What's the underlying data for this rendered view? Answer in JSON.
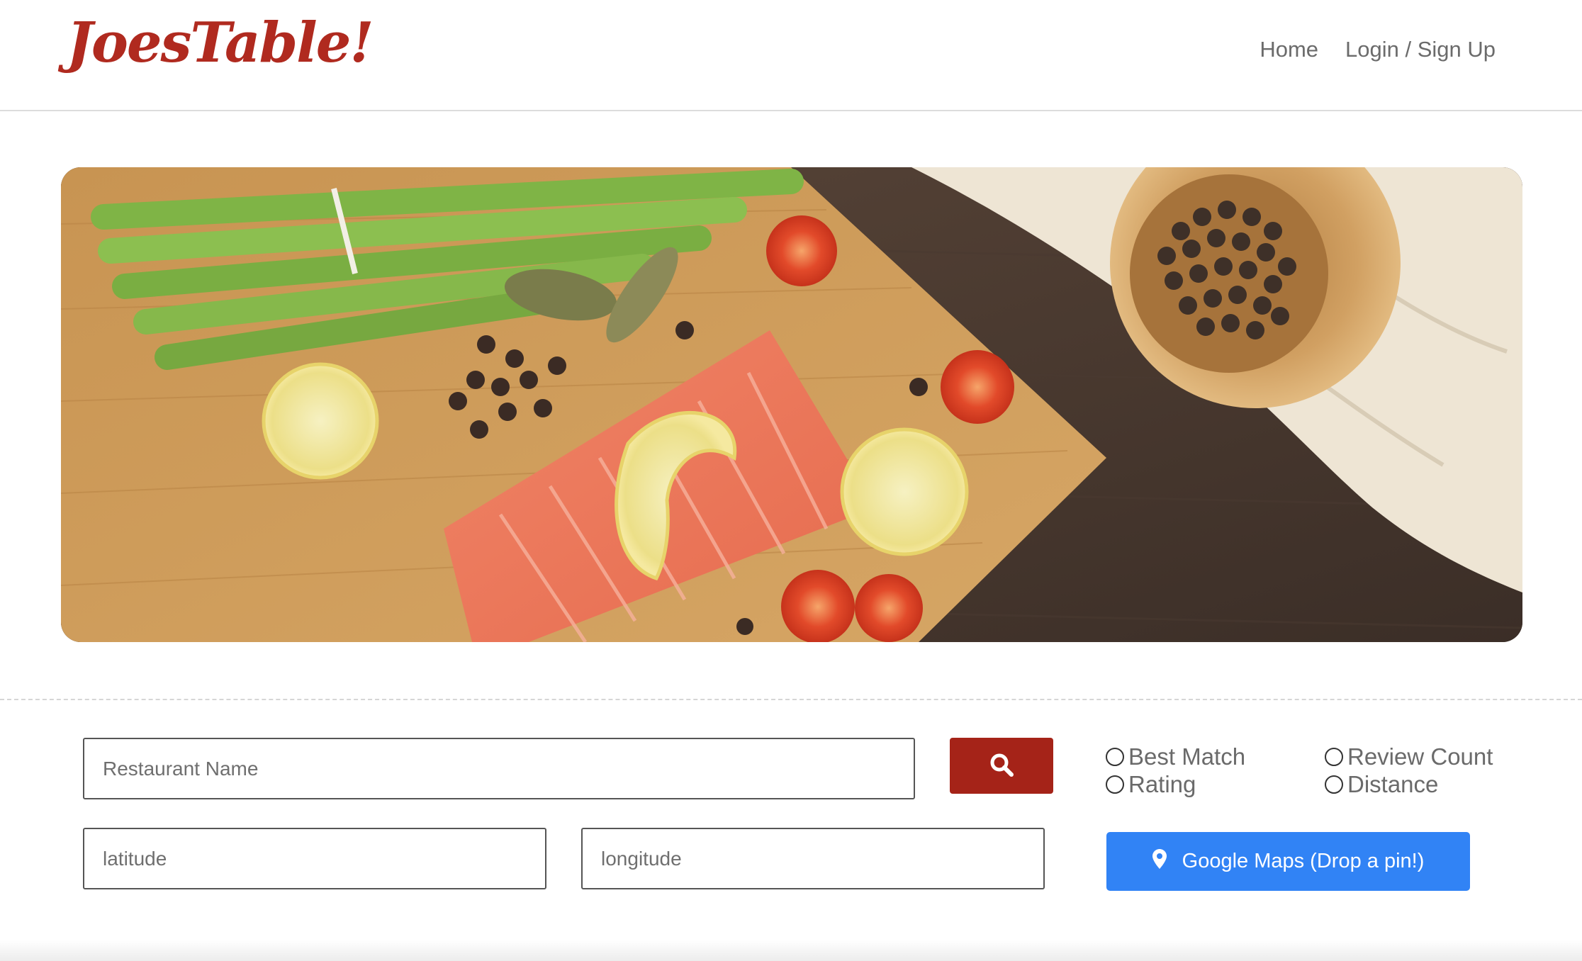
{
  "header": {
    "logo_text": "JoesTable!",
    "nav": [
      {
        "label": "Home"
      },
      {
        "label": "Login / Sign Up"
      }
    ]
  },
  "hero": {
    "icon": "food-photo-salmon-asparagus-lemon-peppercorns"
  },
  "search": {
    "restaurant_placeholder": "Restaurant Name",
    "latitude_placeholder": "latitude",
    "longitude_placeholder": "longitude",
    "search_icon": "search-icon"
  },
  "sort": {
    "options": [
      {
        "label": "Best Match"
      },
      {
        "label": "Review Count"
      },
      {
        "label": "Rating"
      },
      {
        "label": "Distance"
      }
    ]
  },
  "maps": {
    "label": "Google Maps (Drop a pin!)",
    "icon": "map-pin-icon"
  },
  "colors": {
    "brand": "#b02a1f",
    "search_button": "#a52318",
    "maps_button": "#3183f5",
    "nav_text": "#6b6b6b"
  }
}
